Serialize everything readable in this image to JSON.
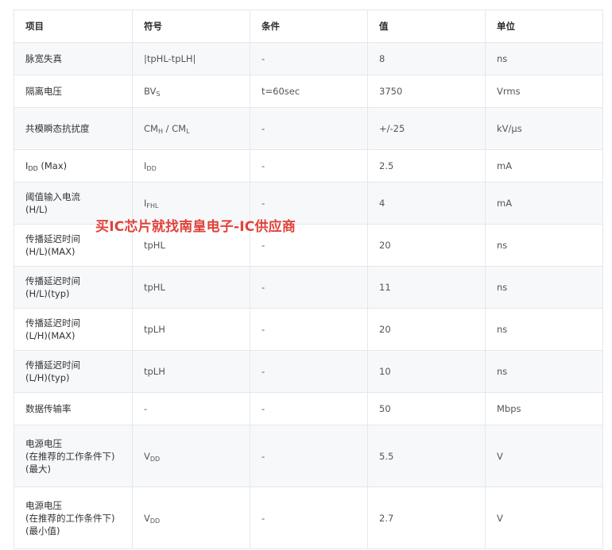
{
  "colors": {
    "border": "#e4e7ec",
    "stripe": "#f7f8fa",
    "watermark": "#e0423a"
  },
  "headers": [
    "项目",
    "符号",
    "条件",
    "值",
    "单位"
  ],
  "rows": [
    {
      "item": "脉宽失真",
      "symbol": "|tpHL-tpLH|",
      "condition": "-",
      "value": "8",
      "unit": "ns"
    },
    {
      "item": "隔离电压",
      "symbol": {
        "main": "BV",
        "sub": "S"
      },
      "condition": "t=60sec",
      "value": "3750",
      "unit": "Vrms"
    },
    {
      "item": "共模瞬态抗扰度",
      "symbol": {
        "a_main": "CM",
        "a_sub": "H",
        "sep": " / ",
        "b_main": "CM",
        "b_sub": "L"
      },
      "condition": "-",
      "value": "+/-25",
      "unit": "kV/μs"
    },
    {
      "item": {
        "main": "I",
        "sub": "DD",
        "suffix": " (Max)"
      },
      "symbol": {
        "main": "I",
        "sub": "DD"
      },
      "condition": "-",
      "value": "2.5",
      "unit": "mA"
    },
    {
      "item": [
        "阈值输入电流",
        "(H/L)"
      ],
      "symbol": {
        "main": "I",
        "sub": "FHL"
      },
      "condition": "-",
      "value": "4",
      "unit": "mA"
    },
    {
      "item": [
        "传播延迟时间",
        "(H/L)(MAX)"
      ],
      "symbol": "tpHL",
      "condition": "-",
      "value": "20",
      "unit": "ns"
    },
    {
      "item": [
        "传播延迟时间",
        "(H/L)(typ)"
      ],
      "symbol": "tpHL",
      "condition": "-",
      "value": "11",
      "unit": "ns"
    },
    {
      "item": [
        "传播延迟时间",
        "(L/H)(MAX)"
      ],
      "symbol": "tpLH",
      "condition": "-",
      "value": "20",
      "unit": "ns"
    },
    {
      "item": [
        "传播延迟时间",
        "(L/H)(typ)"
      ],
      "symbol": "tpLH",
      "condition": "-",
      "value": "10",
      "unit": "ns"
    },
    {
      "item": "数据传输率",
      "symbol": "-",
      "condition": "-",
      "value": "50",
      "unit": "Mbps"
    },
    {
      "item": [
        "电源电压",
        "(在推荐的工作条件下)",
        "(最大)"
      ],
      "symbol": {
        "main": "V",
        "sub": "DD"
      },
      "condition": "-",
      "value": "5.5",
      "unit": "V"
    },
    {
      "item": [
        "电源电压",
        "(在推荐的工作条件下)",
        "(最小值)"
      ],
      "symbol": {
        "main": "V",
        "sub": "DD"
      },
      "condition": "-",
      "value": "2.7",
      "unit": "V"
    }
  ],
  "watermark": "买IC芯片就找南皇电子-IC供应商"
}
